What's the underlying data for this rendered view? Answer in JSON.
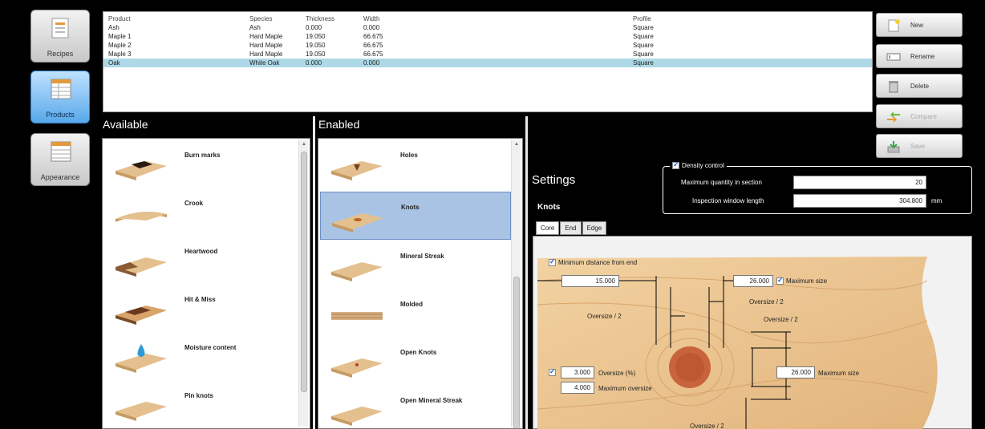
{
  "rail": {
    "recipes": "Recipes",
    "products": "Products",
    "appearance": "Appearance"
  },
  "table": {
    "headers": [
      "Product",
      "Species",
      "Thickness",
      "Width",
      "Profile"
    ],
    "rows": [
      [
        "Ash",
        "Ash",
        "0.000",
        "0.000",
        "Square"
      ],
      [
        "Maple 1",
        "Hard Maple",
        "19.050",
        "66.675",
        "Square"
      ],
      [
        "Maple 2",
        "Hard Maple",
        "19.050",
        "66.675",
        "Square"
      ],
      [
        "Maple 3",
        "Hard Maple",
        "19.050",
        "66.675",
        "Square"
      ],
      [
        "Oak",
        "White Oak",
        "0.000",
        "0.000",
        "Square"
      ]
    ],
    "selected_row": "Oak"
  },
  "buttons": {
    "new": "New",
    "rename": "Rename",
    "delete": "Delete",
    "compare": "Compare",
    "save": "Save"
  },
  "available": {
    "title": "Available",
    "items": [
      "Burn marks",
      "Crook",
      "Heartwood",
      "Hit & Miss",
      "Moisture content",
      "Pin knots"
    ]
  },
  "enabled": {
    "title": "Enabled",
    "items": [
      "Holes",
      "Knots",
      "Mineral Streak",
      "Molded",
      "Open Knots",
      "Open Mineral Streak"
    ],
    "selected": "Knots"
  },
  "settings": {
    "title": "Settings",
    "defect": "Knots",
    "density": {
      "label": "Density control",
      "checked": true,
      "max_qty_label": "Maximum quantity in section",
      "max_qty_value": "20",
      "window_label": "Inspection window length",
      "window_value": "304.800",
      "window_unit": "mm"
    },
    "tabs": [
      "Core",
      "End",
      "Edge"
    ],
    "active_tab": "Core",
    "core": {
      "min_distance_label": "Minimum distance from end",
      "min_distance_value": "15.000",
      "max_size_top_value": "26.000",
      "max_size_top_label": "Maximum size",
      "oversize_half_a": "Oversize / 2",
      "oversize_half_b": "Oversize / 2",
      "oversize_half_c": "Oversize / 2",
      "oversize_pct_value": "3.000",
      "oversize_pct_label": "Oversize (%)",
      "max_oversize_value": "4.000",
      "max_oversize_label": "Maximum oversize",
      "max_size_right_value": "26.000",
      "max_size_right_label": "Maximum size",
      "oversize_half_bottom": "Oversize / 2"
    }
  },
  "colors": {
    "background": "#000000",
    "selection": "#add8e6",
    "enabled_selection": "#a9c3e4",
    "active_rail": "#58a8ea"
  }
}
